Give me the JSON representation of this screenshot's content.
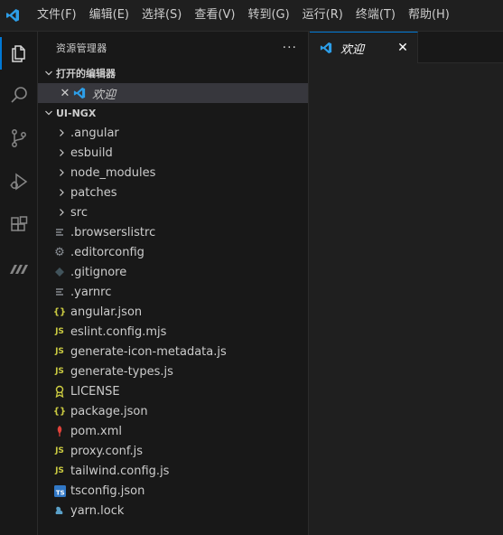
{
  "menu": [
    "文件(F)",
    "编辑(E)",
    "选择(S)",
    "查看(V)",
    "转到(G)",
    "运行(R)",
    "终端(T)",
    "帮助(H)"
  ],
  "activity_bar": {
    "items": [
      "explorer-icon",
      "search-icon",
      "source-control-icon",
      "run-debug-icon",
      "extensions-icon",
      "remote-icon"
    ],
    "active": "explorer-icon",
    "accent": "#0078d4"
  },
  "sidebar": {
    "title": "资源管理器",
    "more": "···",
    "open_editors": {
      "header": "打开的编辑器",
      "items": [
        {
          "label": "欢迎"
        }
      ]
    },
    "workspace": {
      "header": "UI-NGX",
      "folders": [
        ".angular",
        "esbuild",
        "node_modules",
        "patches",
        "src"
      ],
      "files": [
        {
          "name": ".browserslistrc",
          "icon": "lines-icon"
        },
        {
          "name": ".editorconfig",
          "icon": "gear-icon"
        },
        {
          "name": ".gitignore",
          "icon": "git-diamond-icon"
        },
        {
          "name": ".yarnrc",
          "icon": "lines-icon"
        },
        {
          "name": "angular.json",
          "icon": "json-braces-icon"
        },
        {
          "name": "eslint.config.mjs",
          "icon": "js-icon"
        },
        {
          "name": "generate-icon-metadata.js",
          "icon": "js-icon"
        },
        {
          "name": "generate-types.js",
          "icon": "js-icon"
        },
        {
          "name": "LICENSE",
          "icon": "license-ribbon-icon"
        },
        {
          "name": "package.json",
          "icon": "json-braces-icon"
        },
        {
          "name": "pom.xml",
          "icon": "maven-feather-icon"
        },
        {
          "name": "proxy.conf.js",
          "icon": "js-icon"
        },
        {
          "name": "tailwind.config.js",
          "icon": "js-icon"
        },
        {
          "name": "tsconfig.json",
          "icon": "ts-icon"
        },
        {
          "name": "yarn.lock",
          "icon": "yarn-icon"
        }
      ]
    }
  },
  "editor": {
    "tabs": [
      {
        "label": "欢迎",
        "active": true
      }
    ]
  }
}
